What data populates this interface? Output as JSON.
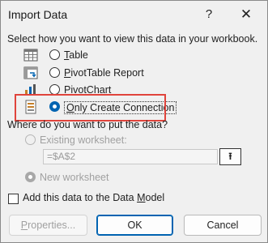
{
  "dialog": {
    "title": "Import Data",
    "help_glyph": "?",
    "close_glyph": "✕"
  },
  "view_section": {
    "prompt": "Select how you want to view this data in your workbook.",
    "options": [
      {
        "label": "Table",
        "accesskey": "T",
        "selected": false
      },
      {
        "label": "PivotTable Report",
        "accesskey": "P",
        "selected": false
      },
      {
        "label": "PivotChart",
        "accesskey": "C",
        "selected": false
      },
      {
        "label": "Only Create Connection",
        "accesskey": "O",
        "selected": true
      }
    ]
  },
  "destination_section": {
    "prompt": "Where do you want to put the data?",
    "existing_label": "Existing worksheet:",
    "reference_value": "=$A$2",
    "ref_button_glyph": "⭱",
    "new_label": "New worksheet"
  },
  "data_model_checkbox": {
    "label": "Add this data to the Data Model",
    "checked": false
  },
  "buttons": {
    "properties": "Properties...",
    "ok": "OK",
    "cancel": "Cancel"
  },
  "colors": {
    "selection_accent": "#0063b1",
    "highlight_box": "#e0443c"
  }
}
